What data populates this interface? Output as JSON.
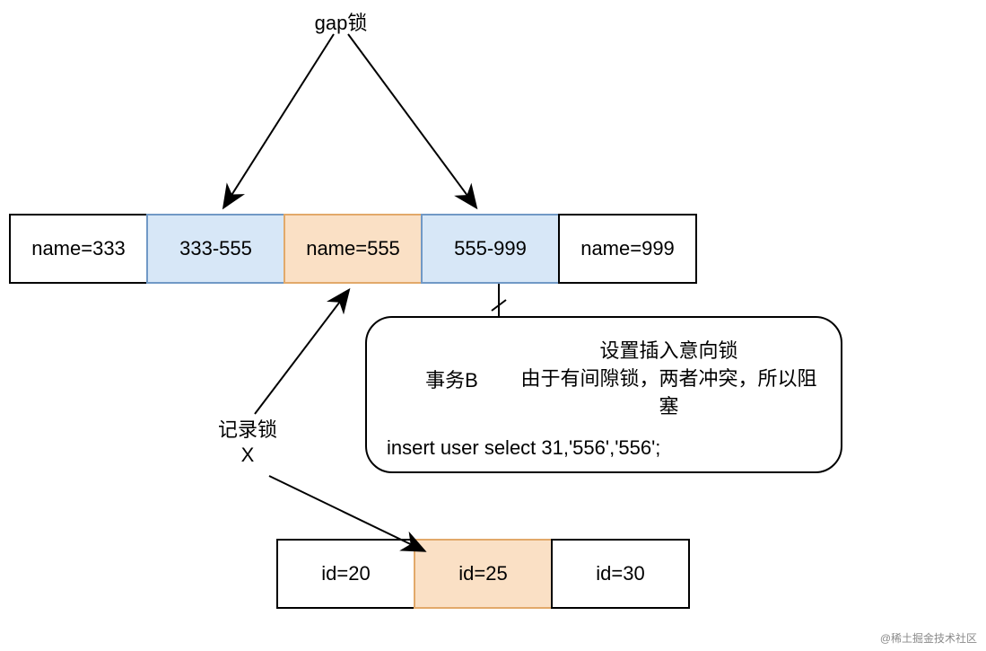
{
  "labels": {
    "gap_lock": "gap锁",
    "record_lock_line1": "记录锁",
    "record_lock_line2": "X"
  },
  "row1": {
    "cells": [
      {
        "text": "name=333"
      },
      {
        "text": "333-555"
      },
      {
        "text": "name=555"
      },
      {
        "text": "555-999"
      },
      {
        "text": "name=999"
      }
    ]
  },
  "row2": {
    "cells": [
      {
        "text": "id=20"
      },
      {
        "text": "id=25"
      },
      {
        "text": "id=30"
      }
    ]
  },
  "info_box": {
    "transaction_label": "事务B",
    "line1": "设置插入意向锁",
    "line2": "由于有间隙锁，两者冲突，所以阻塞",
    "sql": "insert user select 31,'556','556';"
  },
  "watermark": "@稀土掘金技术社区"
}
